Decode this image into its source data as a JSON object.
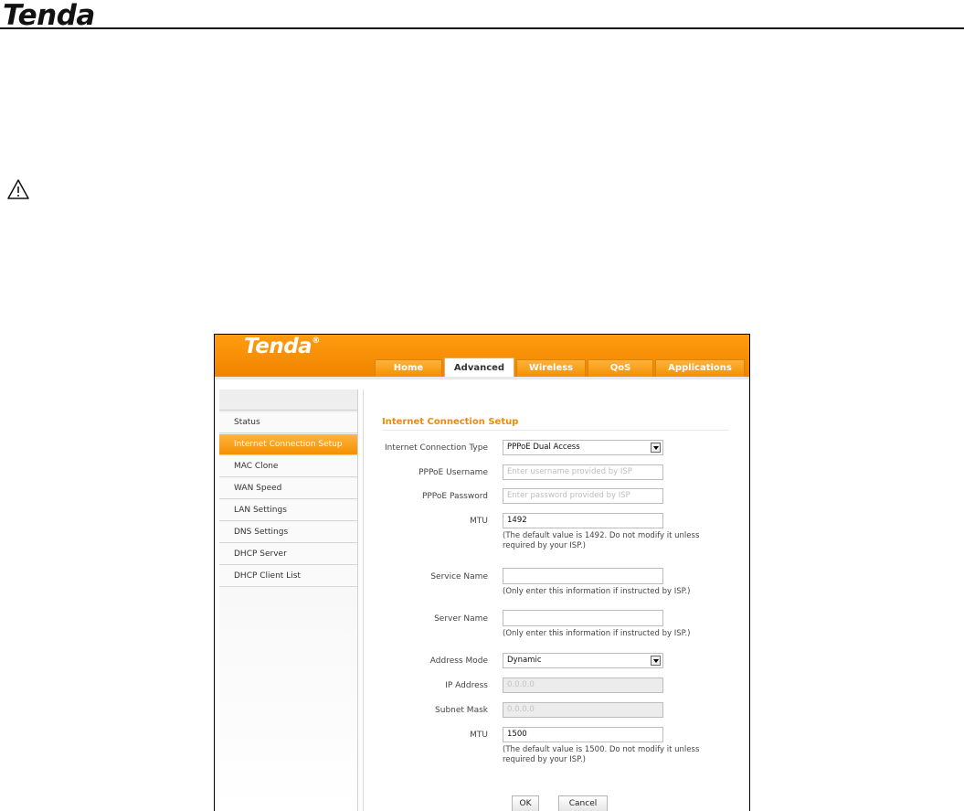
{
  "document": {
    "logo_text": "Tenda"
  },
  "app": {
    "logo_text": "Tenda",
    "logo_mark": "®",
    "brand_color": "#f59000"
  },
  "nav": {
    "tabs": [
      {
        "label": "Home"
      },
      {
        "label": "Advanced",
        "active": true
      },
      {
        "label": "Wireless"
      },
      {
        "label": "QoS"
      },
      {
        "label": "Applications"
      }
    ]
  },
  "sidebar": {
    "items": [
      {
        "label": "Status"
      },
      {
        "label": "Internet Connection Setup",
        "active": true
      },
      {
        "label": "MAC Clone"
      },
      {
        "label": "WAN Speed"
      },
      {
        "label": "LAN Settings"
      },
      {
        "label": "DNS Settings"
      },
      {
        "label": "DHCP Server"
      },
      {
        "label": "DHCP Client List"
      }
    ]
  },
  "form": {
    "title": "Internet Connection Setup",
    "connection_type": {
      "label": "Internet Connection Type",
      "value": "PPPoE Dual Access"
    },
    "username": {
      "label": "PPPoE Username",
      "placeholder": "Enter username provided by ISP"
    },
    "password": {
      "label": "PPPoE Password",
      "placeholder": "Enter password provided by ISP"
    },
    "mtu1": {
      "label": "MTU",
      "value": "1492",
      "hint": "(The default value is 1492. Do not modify it unless required by your ISP.)"
    },
    "service_name": {
      "label": "Service Name",
      "value": "",
      "hint": "(Only enter this information if instructed by ISP.)"
    },
    "server_name": {
      "label": "Server Name",
      "value": "",
      "hint": "(Only enter this information if instructed by ISP.)"
    },
    "address_mode": {
      "label": "Address Mode",
      "value": "Dynamic"
    },
    "ip_address": {
      "label": "IP Address",
      "value": "0.0.0.0"
    },
    "subnet_mask": {
      "label": "Subnet Mask",
      "value": "0.0.0.0"
    },
    "mtu2": {
      "label": "MTU",
      "value": "1500",
      "hint": "(The default value is 1500. Do not modify it unless required by your ISP.)"
    },
    "ok_label": "OK",
    "cancel_label": "Cancel"
  }
}
